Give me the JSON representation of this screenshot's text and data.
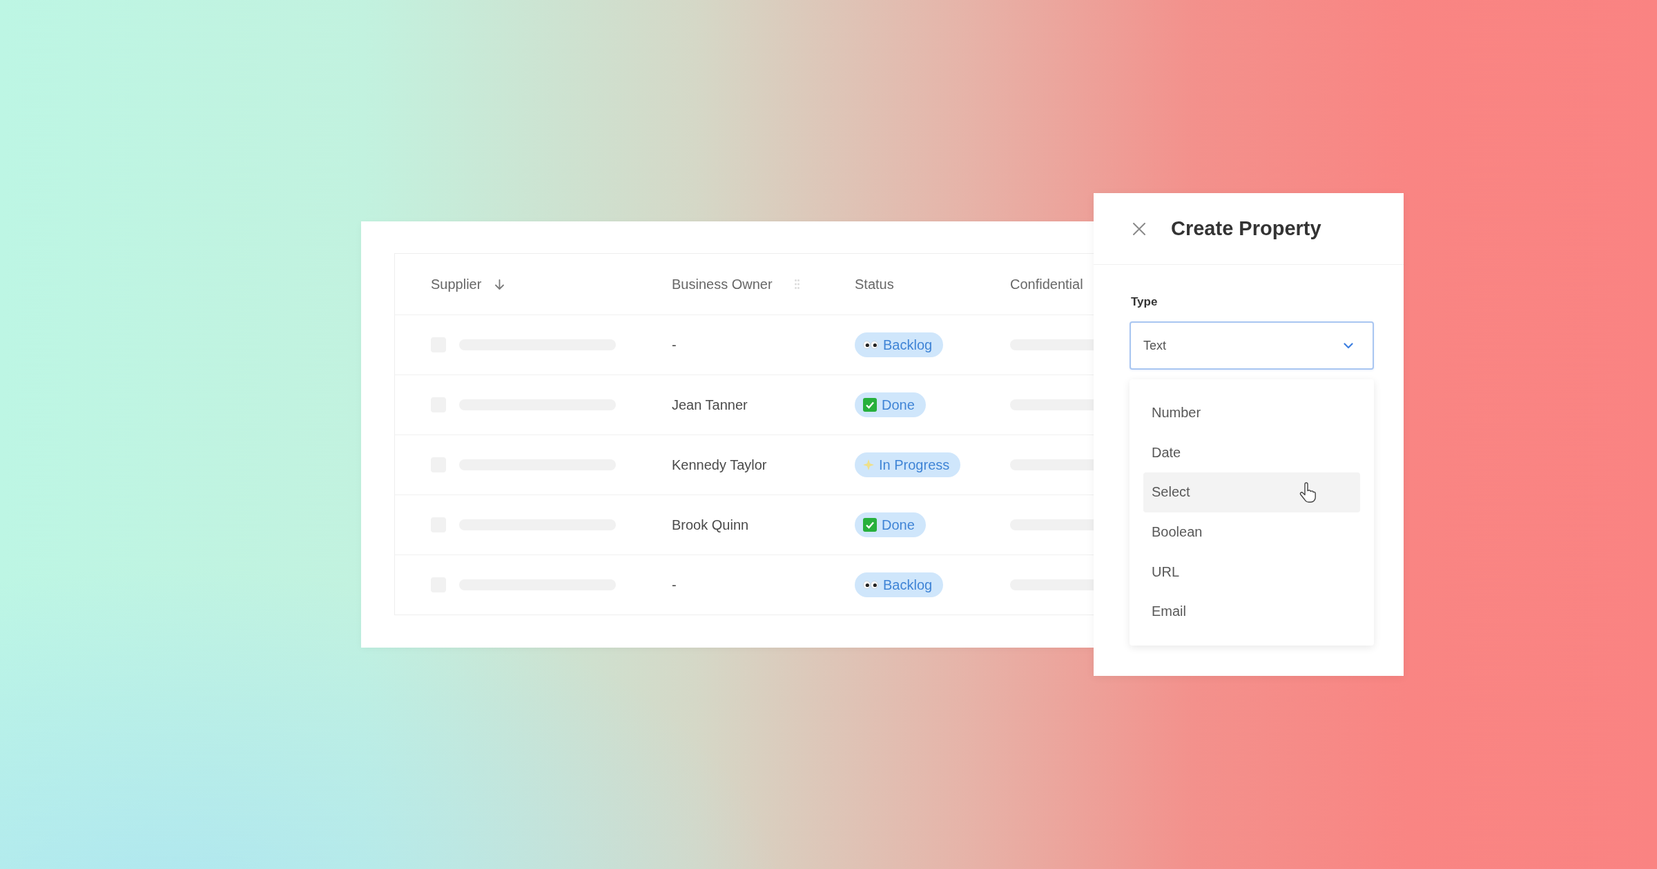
{
  "table": {
    "columns": [
      {
        "label": "Supplier",
        "sorted": true,
        "hovered": false
      },
      {
        "label": "Business Owner",
        "sorted": false,
        "hovered": true
      },
      {
        "label": "Status",
        "sorted": false,
        "hovered": false
      },
      {
        "label": "Confidential",
        "sorted": false,
        "hovered": false
      }
    ],
    "rows": [
      {
        "owner": "-",
        "status": {
          "label": "Backlog",
          "kind": "backlog"
        }
      },
      {
        "owner": "Jean Tanner",
        "status": {
          "label": "Done",
          "kind": "done"
        }
      },
      {
        "owner": "Kennedy Taylor",
        "status": {
          "label": "In Progress",
          "kind": "in_progress"
        }
      },
      {
        "owner": "Brook Quinn",
        "status": {
          "label": "Done",
          "kind": "done"
        }
      },
      {
        "owner": "-",
        "status": {
          "label": "Backlog",
          "kind": "backlog"
        }
      }
    ]
  },
  "panel": {
    "title": "Create Property",
    "field": {
      "label": "Type",
      "value": "Text"
    },
    "options": [
      {
        "label": "Number",
        "hovered": false
      },
      {
        "label": "Date",
        "hovered": false
      },
      {
        "label": "Select",
        "hovered": true
      },
      {
        "label": "Boolean",
        "hovered": false
      },
      {
        "label": "URL",
        "hovered": false
      },
      {
        "label": "Email",
        "hovered": false
      }
    ]
  }
}
